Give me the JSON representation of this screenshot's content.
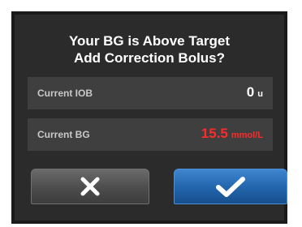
{
  "dialog": {
    "title_line1": "Your BG is Above Target",
    "title_line2": "Add Correction Bolus?"
  },
  "rows": [
    {
      "label": "Current IOB",
      "value": "0",
      "unit": "u",
      "value_color": "#ffffff"
    },
    {
      "label": "Current BG",
      "value": "15.5",
      "unit": "mmol/L",
      "value_color": "#ff2a2a"
    }
  ],
  "buttons": {
    "cancel_icon": "x-icon",
    "confirm_icon": "checkmark-icon"
  },
  "colors": {
    "dialog_bg": "#2b2b2b",
    "row_bg": "#3f3f3f",
    "alert_red": "#ff2a2a",
    "confirm_blue": "#2264ac"
  }
}
